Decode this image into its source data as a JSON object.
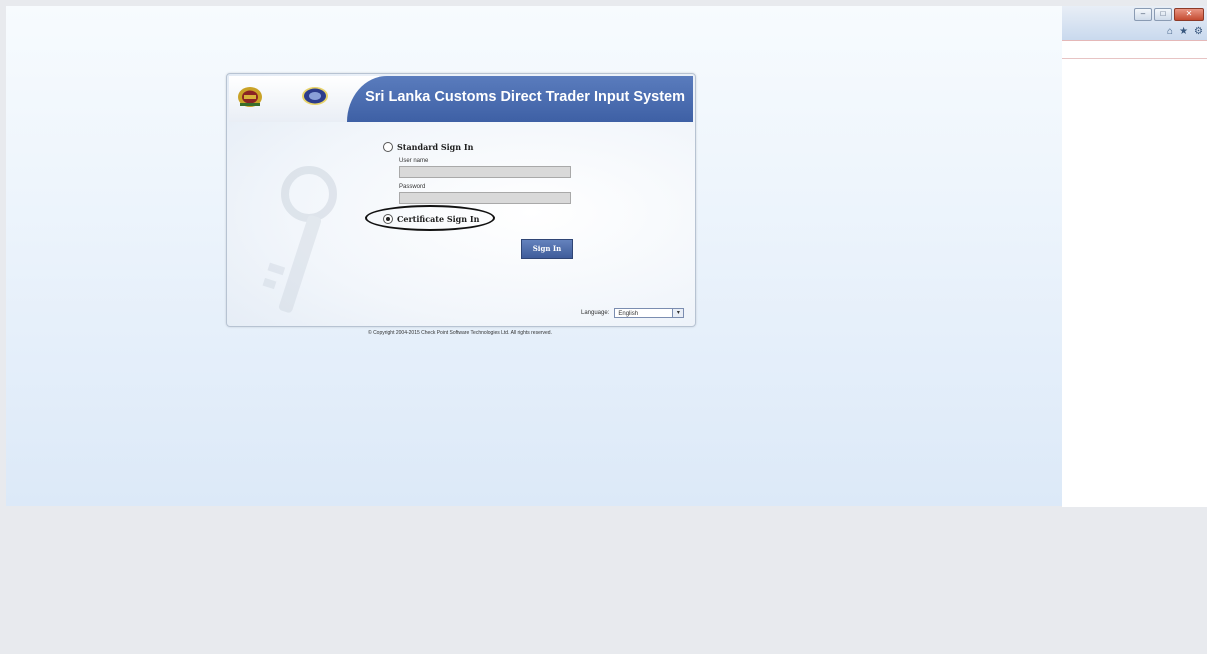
{
  "header": {
    "title": "Sri Lanka Customs Direct Trader Input System"
  },
  "form": {
    "standard_label": "Standard Sign In",
    "username_label": "User name",
    "username_value": "",
    "password_label": "Password",
    "password_value": "",
    "certificate_label": "Certificate Sign In",
    "selected_method": "Certificate Sign In",
    "signin_label": "Sign In"
  },
  "language": {
    "label": "Language:",
    "selected": "English"
  },
  "footer": {
    "copyright": "© Copyright 2004-2015  Check Point Software Technologies Ltd. All rights reserved."
  },
  "colors": {
    "header_blue": "#3e60a5",
    "button_blue": "#4a68a8"
  },
  "browser": {
    "controls": [
      "minimize-icon",
      "restore-icon",
      "close-icon"
    ],
    "toolbar_icons": [
      "home-icon",
      "star-icon",
      "gear-icon"
    ]
  }
}
